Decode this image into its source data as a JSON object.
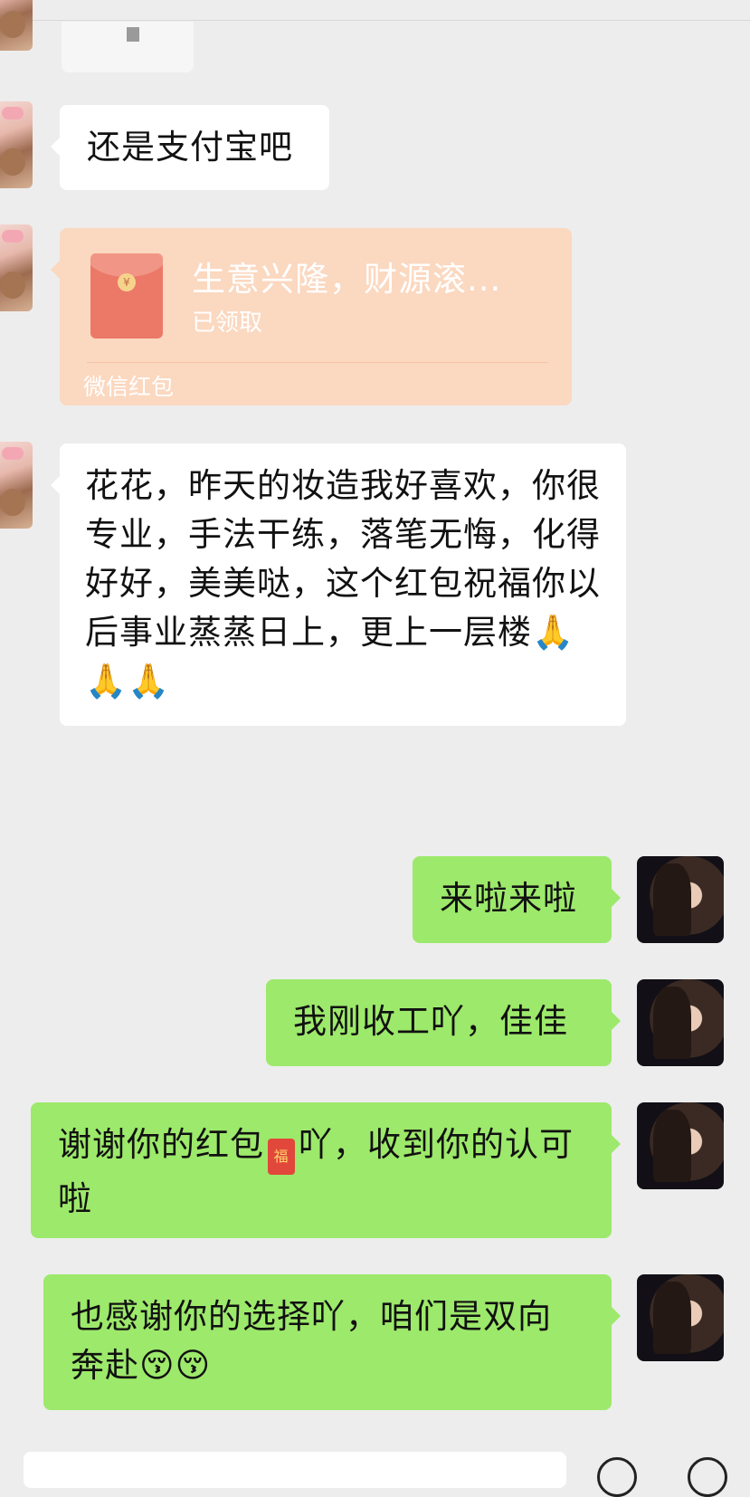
{
  "messages": {
    "m1_text": "还是支付宝吧",
    "redpacket": {
      "title": "生意兴隆，财源滚...",
      "status": "已领取",
      "label": "微信红包",
      "icon": "red-envelope-icon"
    },
    "m3_text": "花花，昨天的妆造我好喜欢，你很专业，手法干练，落笔无悔，化得好好，美美哒，这个红包祝福你以后事业蒸蒸日上，更上一层楼🙏🙏🙏",
    "m4_text": "来啦来啦",
    "m5_text": "我刚收工吖，佳佳",
    "m6_part1": "谢谢你的红包",
    "m6_emoji": "福",
    "m6_part2": "吖，收到你的认可啦",
    "m7_text": "也感谢你的选择吖，咱们是双向奔赴😚😚"
  },
  "colors": {
    "background": "#ededed",
    "incoming_bubble": "#ffffff",
    "outgoing_bubble": "#9de96b",
    "redpacket_bg": "#fbd8c0",
    "redpacket_icon": "#ec7868"
  }
}
